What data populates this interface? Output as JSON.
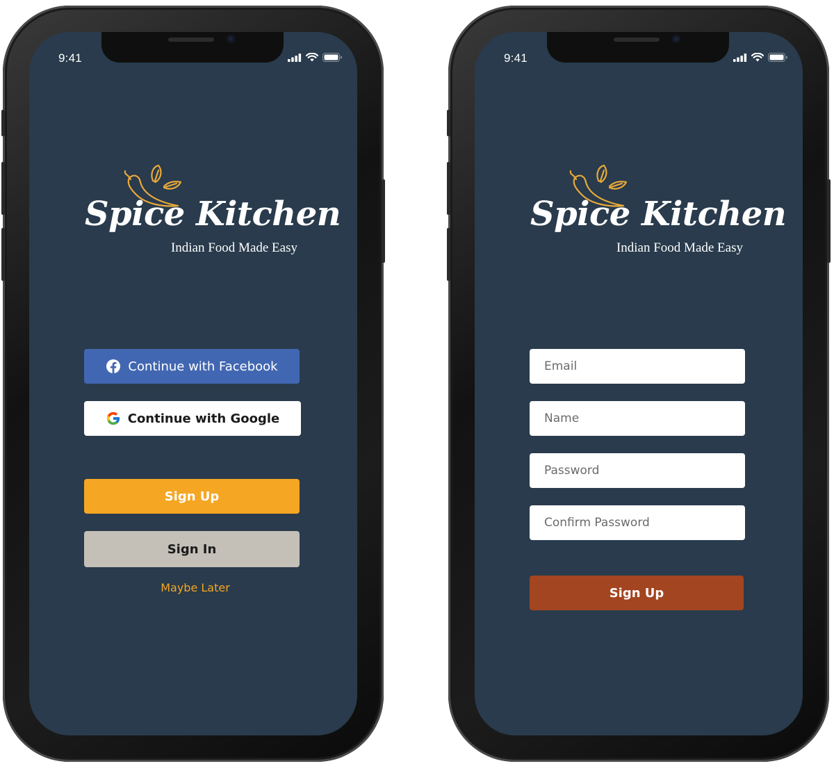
{
  "status_bar": {
    "time": "9:41"
  },
  "brand": {
    "name": "Spice Kitchen",
    "tagline": "Indian Food Made Easy"
  },
  "colors": {
    "screen_background": "#293b4c",
    "facebook_blue": "#4267b2",
    "accent_orange": "#f5a623",
    "sign_in_gray": "#c4c0b8",
    "submit_rust": "#a34521",
    "logo_gold": "#e8a93a"
  },
  "welcome_screen": {
    "facebook_label": "Continue with Facebook",
    "facebook_icon": "facebook-icon",
    "google_label": "Continue with Google",
    "google_icon": "google-icon",
    "sign_up_label": "Sign Up",
    "sign_in_label": "Sign In",
    "maybe_later_label": "Maybe Later"
  },
  "signup_screen": {
    "email_placeholder": "Email",
    "name_placeholder": "Name",
    "password_placeholder": "Password",
    "confirm_password_placeholder": "Confirm Password",
    "submit_label": "Sign Up"
  }
}
